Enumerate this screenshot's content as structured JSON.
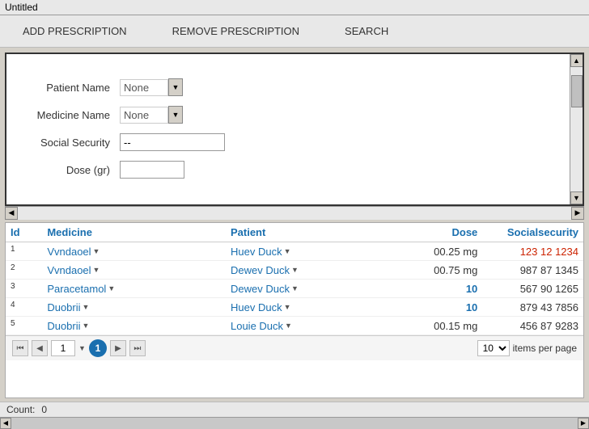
{
  "titleBar": {
    "title": "Untitled"
  },
  "nav": {
    "items": [
      {
        "id": "add-prescription",
        "label": "ADD PRESCRIPTION"
      },
      {
        "id": "remove-prescription",
        "label": "REMOVE PRESCRIPTION"
      },
      {
        "id": "search",
        "label": "SEARCH"
      }
    ]
  },
  "form": {
    "patientName": {
      "label": "Patient Name",
      "value": "None",
      "placeholder": "None"
    },
    "medicineName": {
      "label": "Medicine Name",
      "value": "None",
      "placeholder": "None"
    },
    "socialSecurity": {
      "label": "Social Security",
      "value": "--"
    },
    "dose": {
      "label": "Dose (gr)",
      "value": ""
    }
  },
  "table": {
    "headers": [
      {
        "id": "id",
        "label": "Id"
      },
      {
        "id": "medicine",
        "label": "Medicine"
      },
      {
        "id": "patient",
        "label": "Patient"
      },
      {
        "id": "dose",
        "label": "Dose"
      },
      {
        "id": "socialsecurity",
        "label": "Socialsecurity"
      }
    ],
    "rows": [
      {
        "id": "1",
        "medicine": "Vvndaoel",
        "patient": "Huev Duck",
        "dose": "00.25 mg",
        "doseColor": "normal",
        "socialsecurity": "123 12 1234",
        "ssColor": "red"
      },
      {
        "id": "2",
        "medicine": "Vvndaoel",
        "patient": "Dewev Duck",
        "dose": "00.75 mg",
        "doseColor": "normal",
        "socialsecurity": "987 87 1345",
        "ssColor": "normal"
      },
      {
        "id": "3",
        "medicine": "Paracetamol",
        "patient": "Dewev Duck",
        "dose": "10",
        "doseColor": "blue",
        "socialsecurity": "567 90 1265",
        "ssColor": "normal"
      },
      {
        "id": "4",
        "medicine": "Duobrii",
        "patient": "Huev Duck",
        "dose": "10",
        "doseColor": "blue",
        "socialsecurity": "879 43 7856",
        "ssColor": "normal"
      },
      {
        "id": "5",
        "medicine": "Duobrii",
        "patient": "Louie Duck",
        "dose": "00.15 mg",
        "doseColor": "normal",
        "socialsecurity": "456 87 9283",
        "ssColor": "normal"
      }
    ]
  },
  "pagination": {
    "pageInputValue": "1",
    "currentPage": "1",
    "itemsPerPage": "10",
    "itemsLabel": "items per page",
    "firstBtn": "⏮",
    "prevBtn": "◀",
    "nextBtn": "▶",
    "lastBtn": "⏭"
  },
  "countBar": {
    "label": "Count:",
    "value": "0"
  }
}
